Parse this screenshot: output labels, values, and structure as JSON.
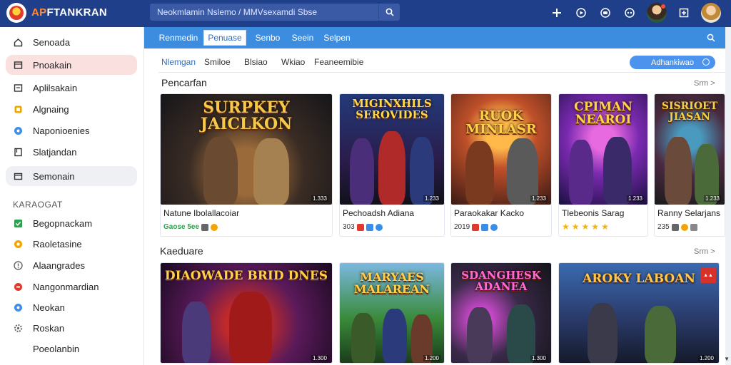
{
  "app": {
    "brand_a": "AP",
    "brand_b": "FTANKRAN"
  },
  "search": {
    "placeholder": "Neokmlamin Nslemo / MMVsexamdi Sbse"
  },
  "sidebar": {
    "items": [
      {
        "label": "Senoada",
        "icon": "home-icon"
      },
      {
        "label": "Pnoakain",
        "icon": "box-icon"
      },
      {
        "label": "Aplilsakain",
        "icon": "apps-icon"
      },
      {
        "label": "Algnaing",
        "icon": "tag-icon"
      },
      {
        "label": "Naponioenies",
        "icon": "info-icon"
      },
      {
        "label": "Slatjandan",
        "icon": "bookmark-icon"
      },
      {
        "label": "Semonain",
        "icon": "window-icon"
      }
    ],
    "section_label": "KARAOGAT",
    "categories": [
      {
        "label": "Begopnackam",
        "icon": "check-icon",
        "color": "#2ea04e"
      },
      {
        "label": "Raoletasine",
        "icon": "coin-icon",
        "color": "#f2a400"
      },
      {
        "label": "Alaangrades",
        "icon": "alert-icon",
        "color": "#666666"
      },
      {
        "label": "Nangonmardian",
        "icon": "stop-icon",
        "color": "#e03a2e"
      },
      {
        "label": "Neokan",
        "icon": "circle-icon",
        "color": "#3a8ee8"
      },
      {
        "label": "Roskan",
        "icon": "gear-icon",
        "color": "#666666"
      },
      {
        "label": "Poeolanbin",
        "icon": "",
        "color": ""
      }
    ]
  },
  "catbar": {
    "tabs": [
      "Renmedin",
      "Penuase",
      "Senbo",
      "Seein",
      "Selpen"
    ],
    "active": 1
  },
  "filters": {
    "tabs": [
      "Nlemgan",
      "Smiloe",
      "Blsiao",
      "Wkiao",
      "Feaneemibie"
    ],
    "active": 0,
    "button_label": "Adhankiwao"
  },
  "section1": {
    "title": "Pencarfan",
    "see_all": "Srm >",
    "cards": [
      {
        "art": "SURPKEY JAICLKON",
        "name": "Natune Ibolallacoiar",
        "size": "1.333",
        "meta": "Gaose 5ee"
      },
      {
        "art": "MIGINXHILS SEROVIDES",
        "name": "Pechoadsh Adiana",
        "size": "1.233",
        "meta": "303"
      },
      {
        "art": "RUOK MINLASR",
        "name": "Paraokakar Kacko",
        "size": "1.233",
        "meta": "2019"
      },
      {
        "art": "CPIMAN NEAROI",
        "name": "Tlebeonis Sarag",
        "size": "1.233",
        "meta": ""
      },
      {
        "art": "SISRIOET JIASAN",
        "name": "Ranny Selarjans",
        "size": "1.233",
        "meta": "235"
      }
    ]
  },
  "section2": {
    "title": "Kaeduare",
    "see_all": "Srm >",
    "cards": [
      {
        "art": "DIAOWADE BRID DNES",
        "size": "1.300"
      },
      {
        "art": "MARYAES MALAREAN",
        "size": "1.200"
      },
      {
        "art": "SDANGHESK ADANEA",
        "size": "1.300"
      },
      {
        "art": "AROKY LABOAN",
        "size": "1.200"
      }
    ]
  },
  "colors": {
    "topbar": "#1f3f8a",
    "catbar": "#3c8ce0",
    "accent": "#4b93ec",
    "active_nav": "#fbe0e0"
  }
}
